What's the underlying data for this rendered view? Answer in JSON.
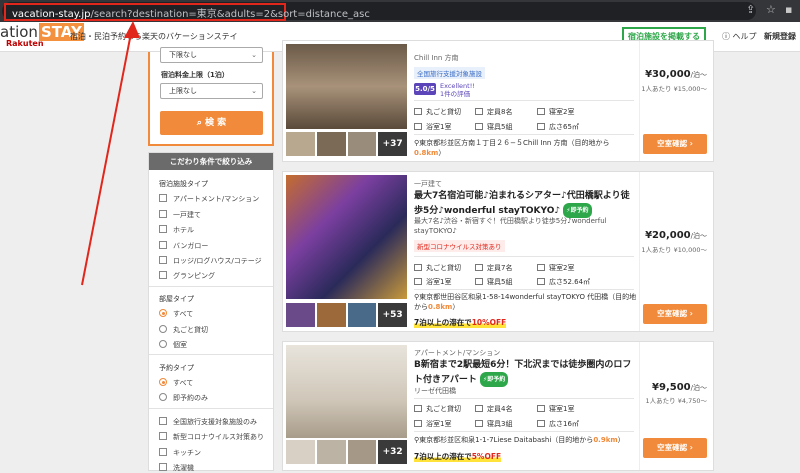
{
  "browser": {
    "url_host": "vacation-stay.jp",
    "url_path": "/search?destination=東京&adults=2&sort=distance_asc"
  },
  "header": {
    "logo_prefix": "ation",
    "logo_stay": "STAY",
    "logo_sub": "Rakuten",
    "tagline": "宿泊・民泊予約なら楽天のバケーションステイ",
    "list_facility_button": "宿泊施設を掲載する",
    "help_label": "ヘルプ",
    "register_label": "新規登録"
  },
  "search_panel": {
    "min_price_value": "下限なし",
    "max_price_label": "宿泊料金上限（1泊）",
    "max_price_value": "上限なし",
    "search_button": "検 索"
  },
  "filters": {
    "title": "こだわり条件で絞り込み",
    "facility_type": {
      "label": "宿泊施設タイプ",
      "options": [
        "アパートメント/マンション",
        "一戸建て",
        "ホテル",
        "バンガロー",
        "ロッジ/ログハウス/コテージ",
        "グランピング"
      ]
    },
    "room_type": {
      "label": "部屋タイプ",
      "options": [
        "すべて",
        "丸ごと貸切",
        "個室"
      ],
      "selected": "すべて"
    },
    "booking_type": {
      "label": "予約タイプ",
      "options": [
        "すべて",
        "即予約のみ"
      ],
      "selected": "すべて"
    },
    "extras": [
      "全国旅行支援対象施設のみ",
      "新型コロナウイルス対策あり",
      "キッチン",
      "洗濯機"
    ]
  },
  "listings": [
    {
      "name": "Chill Inn 方南",
      "badge": "全国旅行支援対象施設",
      "score": "5.0/5",
      "score_label": "Excellent!!",
      "review_count": "1件の評価",
      "amenities": [
        "丸ごと貸切",
        "定員8名",
        "寝室2室",
        "浴室1室",
        "寝具5組",
        "広さ65㎡"
      ],
      "address": "東京都杉並区方南１丁目２６−５Chill Inn 方南（目的地から",
      "distance": "0.8km",
      "price": "¥30,000",
      "price_unit": "/泊～",
      "per_person": "1人あたり ¥15,000～",
      "photo_count": "+37",
      "button": "空室確認"
    },
    {
      "type": "一戸建て",
      "title": "最大7名宿泊可能♪泊まれるシアター♪代田橋駅より徒歩5分♪wonderful stayTOKYO♪",
      "instant_tag": "即予約",
      "description": "最大7名♪渋谷・新宿すぐ！代田橋駅より徒歩5分♪wonderful stayTOKYO♪",
      "badge": "新型コロナウイルス対策あり",
      "amenities": [
        "丸ごと貸切",
        "定員7名",
        "寝室2室",
        "浴室1室",
        "寝具5組",
        "広さ52.64㎡"
      ],
      "address": "東京都世田谷区和泉1-58-14wonderful stayTOKYO 代田橋（目的地から",
      "distance": "0.8km",
      "promo_prefix": "7泊以上の滞在で",
      "promo_discount": "10%OFF",
      "price": "¥20,000",
      "price_unit": "/泊～",
      "per_person": "1人あたり ¥10,000～",
      "photo_count": "+53",
      "button": "空室確認"
    },
    {
      "type": "アパートメント/マンション",
      "title": "B新宿まで2駅最短6分！下北沢までは徒歩圏内のロフト付きアパート",
      "instant_tag": "即予約",
      "description": "リーゼ代田橋",
      "amenities": [
        "丸ごと貸切",
        "定員4名",
        "寝室1室",
        "浴室1室",
        "寝具3組",
        "広さ16㎡"
      ],
      "address": "東京都杉並区和泉1-1-7Liese Daitabashi（目的地から",
      "distance": "0.9km",
      "promo_prefix": "7泊以上の滞在で",
      "promo_discount": "5%OFF",
      "price": "¥9,500",
      "price_unit": "/泊～",
      "per_person": "1人あたり ¥4,750～",
      "photo_count": "+32",
      "button": "空室確認"
    }
  ],
  "colors": {
    "accent_orange": "#f18a3a",
    "brand_green": "#2ea74a",
    "annotation_red": "#e1261c",
    "score_purple": "#5b45b8"
  }
}
